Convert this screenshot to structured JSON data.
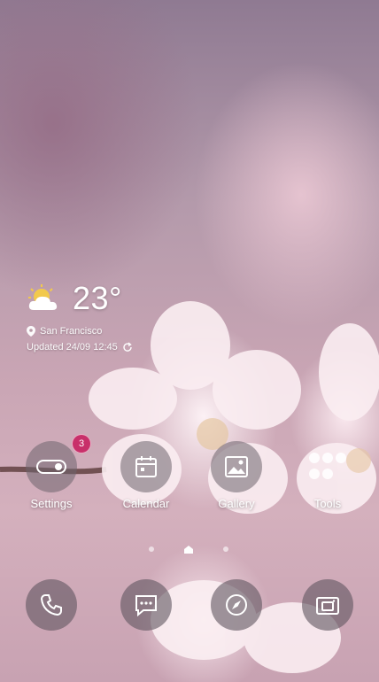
{
  "weather": {
    "temperature": "23°",
    "location": "San Francisco",
    "updated": "Updated 24/09 12:45",
    "icon": "partly-cloudy-icon"
  },
  "apps": [
    {
      "label": "Settings",
      "icon": "toggle-icon",
      "badge": "3"
    },
    {
      "label": "Calendar",
      "icon": "calendar-icon"
    },
    {
      "label": "Gallery",
      "icon": "image-icon"
    },
    {
      "label": "Tools",
      "icon": "grid-icon"
    }
  ],
  "dock": [
    {
      "icon": "phone-icon"
    },
    {
      "icon": "message-icon"
    },
    {
      "icon": "compass-icon"
    },
    {
      "icon": "camera-icon"
    }
  ],
  "page_indicator": {
    "pages": 3,
    "current": 2
  },
  "colors": {
    "badge": "#c8306a"
  }
}
